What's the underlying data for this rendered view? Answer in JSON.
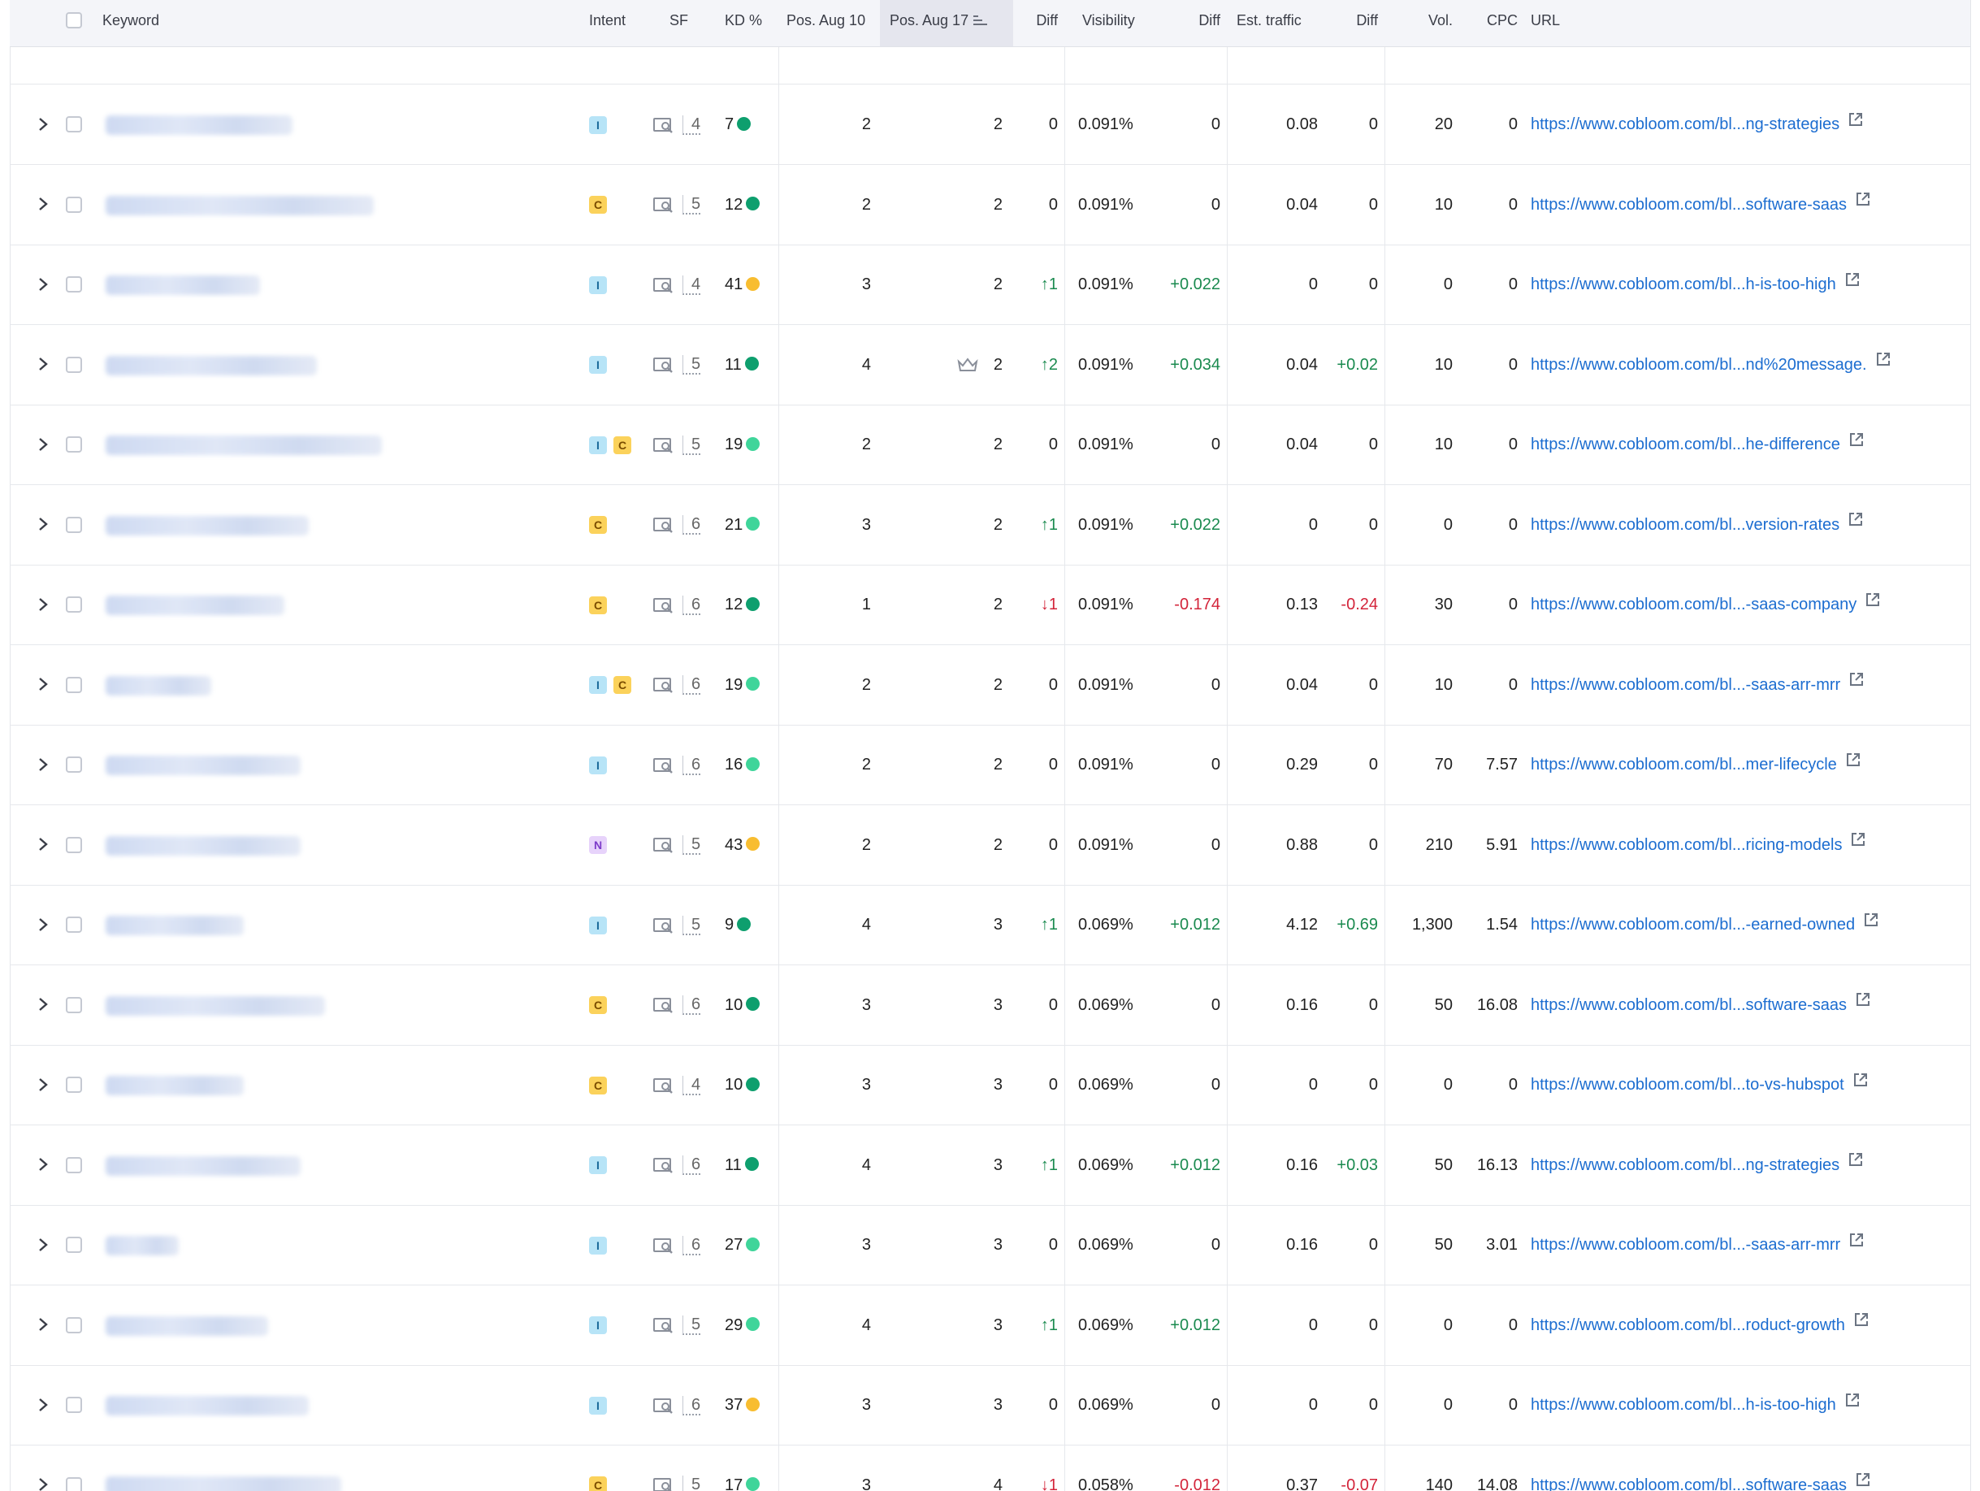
{
  "header": {
    "keyword": "Keyword",
    "intent": "Intent",
    "sf": "SF",
    "kd": "KD %",
    "pos_prev": "Pos. Aug 10",
    "pos_curr": "Pos. Aug 17",
    "diff": "Diff",
    "visibility": "Visibility",
    "vis_diff": "Diff",
    "traffic": "Est. traffic",
    "traffic_diff": "Diff",
    "vol": "Vol.",
    "cpc": "CPC",
    "url": "URL"
  },
  "colors": {
    "kd_dark_green": "#0e9f6e",
    "kd_light_green": "#3fd59a",
    "kd_yellow": "#f8bd30",
    "link": "#1c6dd0",
    "up": "#1a8a4f",
    "down": "#d3243a"
  },
  "rows": [
    {
      "intents": [
        "I"
      ],
      "sf": "4",
      "kd": "7",
      "kd_color": "#0e9f6e",
      "pos_prev": "2",
      "pos_curr": "2",
      "diff": "0",
      "diff_dir": "none",
      "vis": "0.091%",
      "vis_diff": "0",
      "traffic": "0.08",
      "traffic_diff": "0",
      "vol": "20",
      "cpc": "0",
      "url": "https://www.cobloom.com/bl...ng-strategies"
    },
    {
      "intents": [
        "C"
      ],
      "sf": "5",
      "kd": "12",
      "kd_color": "#0e9f6e",
      "pos_prev": "2",
      "pos_curr": "2",
      "diff": "0",
      "diff_dir": "none",
      "vis": "0.091%",
      "vis_diff": "0",
      "traffic": "0.04",
      "traffic_diff": "0",
      "vol": "10",
      "cpc": "0",
      "url": "https://www.cobloom.com/bl...software-saas"
    },
    {
      "intents": [
        "I"
      ],
      "sf": "4",
      "kd": "41",
      "kd_color": "#f8bd30",
      "pos_prev": "3",
      "pos_curr": "2",
      "diff": "1",
      "diff_dir": "up",
      "vis": "0.091%",
      "vis_diff": "+0.022",
      "traffic": "0",
      "traffic_diff": "0",
      "vol": "0",
      "cpc": "0",
      "url": "https://www.cobloom.com/bl...h-is-too-high"
    },
    {
      "intents": [
        "I"
      ],
      "sf": "5",
      "kd": "11",
      "kd_color": "#0e9f6e",
      "pos_prev": "4",
      "pos_curr": "2",
      "crown": true,
      "diff": "2",
      "diff_dir": "up",
      "vis": "0.091%",
      "vis_diff": "+0.034",
      "traffic": "0.04",
      "traffic_diff": "+0.02",
      "vol": "10",
      "cpc": "0",
      "url": "https://www.cobloom.com/bl...nd%20message."
    },
    {
      "intents": [
        "I",
        "C"
      ],
      "sf": "5",
      "kd": "19",
      "kd_color": "#3fd59a",
      "pos_prev": "2",
      "pos_curr": "2",
      "diff": "0",
      "diff_dir": "none",
      "vis": "0.091%",
      "vis_diff": "0",
      "traffic": "0.04",
      "traffic_diff": "0",
      "vol": "10",
      "cpc": "0",
      "url": "https://www.cobloom.com/bl...he-difference"
    },
    {
      "intents": [
        "C"
      ],
      "sf": "6",
      "kd": "21",
      "kd_color": "#3fd59a",
      "pos_prev": "3",
      "pos_curr": "2",
      "diff": "1",
      "diff_dir": "up",
      "vis": "0.091%",
      "vis_diff": "+0.022",
      "traffic": "0",
      "traffic_diff": "0",
      "vol": "0",
      "cpc": "0",
      "url": "https://www.cobloom.com/bl...version-rates"
    },
    {
      "intents": [
        "C"
      ],
      "sf": "6",
      "kd": "12",
      "kd_color": "#0e9f6e",
      "pos_prev": "1",
      "pos_curr": "2",
      "diff": "1",
      "diff_dir": "down",
      "vis": "0.091%",
      "vis_diff": "-0.174",
      "traffic": "0.13",
      "traffic_diff": "-0.24",
      "vol": "30",
      "cpc": "0",
      "url": "https://www.cobloom.com/bl...-saas-company"
    },
    {
      "intents": [
        "I",
        "C"
      ],
      "sf": "6",
      "kd": "19",
      "kd_color": "#3fd59a",
      "pos_prev": "2",
      "pos_curr": "2",
      "diff": "0",
      "diff_dir": "none",
      "vis": "0.091%",
      "vis_diff": "0",
      "traffic": "0.04",
      "traffic_diff": "0",
      "vol": "10",
      "cpc": "0",
      "url": "https://www.cobloom.com/bl...-saas-arr-mrr"
    },
    {
      "intents": [
        "I"
      ],
      "sf": "6",
      "kd": "16",
      "kd_color": "#3fd59a",
      "pos_prev": "2",
      "pos_curr": "2",
      "diff": "0",
      "diff_dir": "none",
      "vis": "0.091%",
      "vis_diff": "0",
      "traffic": "0.29",
      "traffic_diff": "0",
      "vol": "70",
      "cpc": "7.57",
      "url": "https://www.cobloom.com/bl...mer-lifecycle"
    },
    {
      "intents": [
        "N"
      ],
      "sf": "5",
      "kd": "43",
      "kd_color": "#f8bd30",
      "pos_prev": "2",
      "pos_curr": "2",
      "diff": "0",
      "diff_dir": "none",
      "vis": "0.091%",
      "vis_diff": "0",
      "traffic": "0.88",
      "traffic_diff": "0",
      "vol": "210",
      "cpc": "5.91",
      "url": "https://www.cobloom.com/bl...ricing-models"
    },
    {
      "intents": [
        "I"
      ],
      "sf": "5",
      "kd": "9",
      "kd_color": "#0e9f6e",
      "pos_prev": "4",
      "pos_curr": "3",
      "diff": "1",
      "diff_dir": "up",
      "vis": "0.069%",
      "vis_diff": "+0.012",
      "traffic": "4.12",
      "traffic_diff": "+0.69",
      "vol": "1,300",
      "cpc": "1.54",
      "url": "https://www.cobloom.com/bl...-earned-owned"
    },
    {
      "intents": [
        "C"
      ],
      "sf": "6",
      "kd": "10",
      "kd_color": "#0e9f6e",
      "pos_prev": "3",
      "pos_curr": "3",
      "diff": "0",
      "diff_dir": "none",
      "vis": "0.069%",
      "vis_diff": "0",
      "traffic": "0.16",
      "traffic_diff": "0",
      "vol": "50",
      "cpc": "16.08",
      "url": "https://www.cobloom.com/bl...software-saas"
    },
    {
      "intents": [
        "C"
      ],
      "sf": "4",
      "kd": "10",
      "kd_color": "#0e9f6e",
      "pos_prev": "3",
      "pos_curr": "3",
      "diff": "0",
      "diff_dir": "none",
      "vis": "0.069%",
      "vis_diff": "0",
      "traffic": "0",
      "traffic_diff": "0",
      "vol": "0",
      "cpc": "0",
      "url": "https://www.cobloom.com/bl...to-vs-hubspot"
    },
    {
      "intents": [
        "I"
      ],
      "sf": "6",
      "kd": "11",
      "kd_color": "#0e9f6e",
      "pos_prev": "4",
      "pos_curr": "3",
      "diff": "1",
      "diff_dir": "up",
      "vis": "0.069%",
      "vis_diff": "+0.012",
      "traffic": "0.16",
      "traffic_diff": "+0.03",
      "vol": "50",
      "cpc": "16.13",
      "url": "https://www.cobloom.com/bl...ng-strategies"
    },
    {
      "intents": [
        "I"
      ],
      "sf": "6",
      "kd": "27",
      "kd_color": "#3fd59a",
      "pos_prev": "3",
      "pos_curr": "3",
      "diff": "0",
      "diff_dir": "none",
      "vis": "0.069%",
      "vis_diff": "0",
      "traffic": "0.16",
      "traffic_diff": "0",
      "vol": "50",
      "cpc": "3.01",
      "url": "https://www.cobloom.com/bl...-saas-arr-mrr"
    },
    {
      "intents": [
        "I"
      ],
      "sf": "5",
      "kd": "29",
      "kd_color": "#3fd59a",
      "pos_prev": "4",
      "pos_curr": "3",
      "diff": "1",
      "diff_dir": "up",
      "vis": "0.069%",
      "vis_diff": "+0.012",
      "traffic": "0",
      "traffic_diff": "0",
      "vol": "0",
      "cpc": "0",
      "url": "https://www.cobloom.com/bl...roduct-growth"
    },
    {
      "intents": [
        "I"
      ],
      "sf": "6",
      "kd": "37",
      "kd_color": "#f8bd30",
      "pos_prev": "3",
      "pos_curr": "3",
      "diff": "0",
      "diff_dir": "none",
      "vis": "0.069%",
      "vis_diff": "0",
      "traffic": "0",
      "traffic_diff": "0",
      "vol": "0",
      "cpc": "0",
      "url": "https://www.cobloom.com/bl...h-is-too-high"
    },
    {
      "intents": [
        "C"
      ],
      "sf": "5",
      "kd": "17",
      "kd_color": "#3fd59a",
      "pos_prev": "3",
      "pos_curr": "4",
      "diff": "1",
      "diff_dir": "down",
      "vis": "0.058%",
      "vis_diff": "-0.012",
      "traffic": "0.37",
      "traffic_diff": "-0.07",
      "vol": "140",
      "cpc": "14.08",
      "url": "https://www.cobloom.com/bl...software-saas"
    }
  ]
}
